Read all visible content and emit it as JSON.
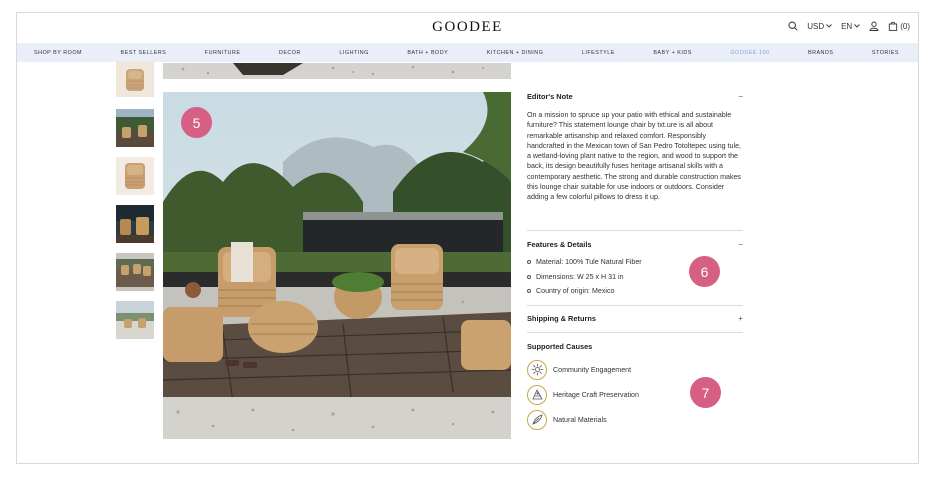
{
  "header": {
    "logo": "GOODEE",
    "currency": "USD",
    "language": "EN",
    "cart": "(0)"
  },
  "nav": [
    "SHOP BY ROOM",
    "BEST SELLERS",
    "FURNITURE",
    "DECOR",
    "LIGHTING",
    "BATH + BODY",
    "KITCHEN + DINING",
    "LIFESTYLE",
    "BABY + KIDS",
    "GOODEE 100",
    "BRANDS",
    "STORIES"
  ],
  "nav_active_index": 9,
  "markers": {
    "m5": "5",
    "m6": "6",
    "m7": "7"
  },
  "product": {
    "editors_note": {
      "title": "Editor's Note",
      "toggle": "−",
      "body": "On a mission to spruce up your patio with ethical and sustainable furniture? This statement lounge chair by txt.ure is all about remarkable artisanship and relaxed comfort. Responsibly handcrafted in the Mexican town of San Pedro Totoltepec using tule, a wetland-loving plant native to the region, and wood to support the back, its design beautifully fuses heritage artisanal skills with a contemporary aesthetic. The strong and durable construction makes this lounge chair suitable for use indoors or outdoors. Consider adding a few colorful pillows to dress it up."
    },
    "features": {
      "title": "Features & Details",
      "toggle": "−",
      "items": [
        "Material: 100% Tule Natural Fiber",
        "Dimensions: W 25 x H 31 in",
        "Country of origin: Mexico"
      ]
    },
    "shipping": {
      "title": "Shipping & Returns",
      "toggle": "+"
    },
    "causes": {
      "title": "Supported Causes",
      "items": [
        {
          "label": "Community Engagement",
          "icon": "community-icon"
        },
        {
          "label": "Heritage Craft Preservation",
          "icon": "heritage-craft-icon"
        },
        {
          "label": "Natural Materials",
          "icon": "natural-materials-icon"
        }
      ]
    }
  },
  "colors": {
    "nav_bg": "#e9eef9",
    "nav_active": "#8aa0d6",
    "marker": "#d65f84",
    "cause_ring": "#c9a64a"
  }
}
